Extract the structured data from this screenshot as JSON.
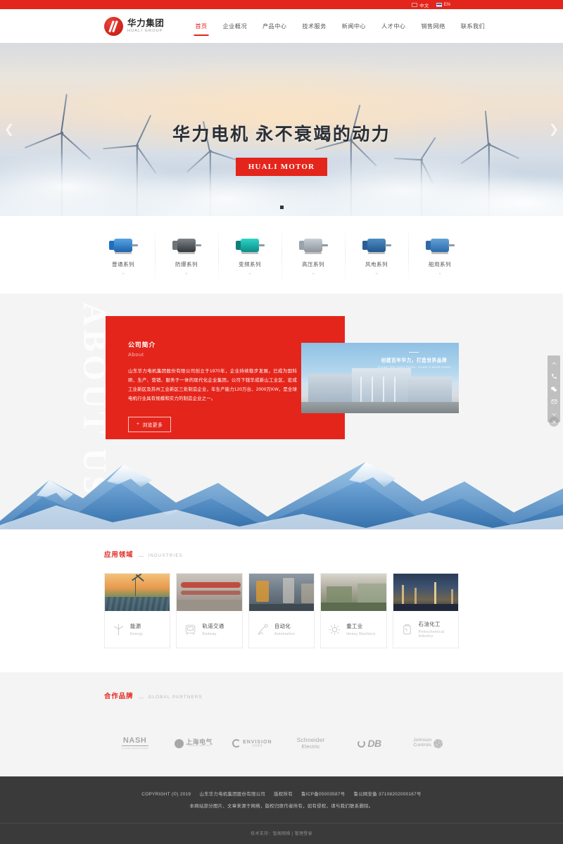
{
  "topbar": {
    "languages": [
      {
        "label": "中文",
        "icon": "cn-flag-icon"
      },
      {
        "label": "EN",
        "icon": "en-flag-icon"
      }
    ]
  },
  "header": {
    "logo_cn": "华力集团",
    "logo_en": "HUALI GROUP",
    "nav": [
      {
        "label": "首页",
        "active": true
      },
      {
        "label": "企业概况",
        "active": false
      },
      {
        "label": "产品中心",
        "active": false
      },
      {
        "label": "技术服务",
        "active": false
      },
      {
        "label": "新闻中心",
        "active": false
      },
      {
        "label": "人才中心",
        "active": false
      },
      {
        "label": "销售网络",
        "active": false
      },
      {
        "label": "联系我们",
        "active": false
      }
    ]
  },
  "hero": {
    "title": "华力电机 永不衰竭的动力",
    "button": "HUALI MOTOR",
    "prev_icon": "chevron-left-icon",
    "next_icon": "chevron-right-icon",
    "slides": 1,
    "active_slide": 1
  },
  "series": {
    "items": [
      {
        "label": "普通系列",
        "color": "#2b7fd0",
        "plus": "+"
      },
      {
        "label": "防爆系列",
        "color": "#4a4a4a",
        "plus": "+"
      },
      {
        "label": "变频系列",
        "color": "#13b3ac",
        "plus": "+"
      },
      {
        "label": "高压系列",
        "color": "#9aa3ab",
        "plus": "+"
      },
      {
        "label": "风电系列",
        "color": "#2f6fa8",
        "plus": "+"
      },
      {
        "label": "船用系列",
        "color": "#3f7fc0",
        "plus": "+"
      }
    ]
  },
  "about": {
    "watermark": "ABOUT US",
    "title": "公司简介",
    "subtitle": "About",
    "paragraph": "山东华力电机集团股份有限公司创立于1970年，企业持续稳步发展，已成为国科研、生产、营销、服务于一体的现代化企业集团。公司下辖华成新山工业区、宏成工业新区及苏州工业新区三处制造企业，年生产能力120万台、2000万KW，是全球电机行业具有规模和实力的制造企业之一。",
    "button": "浏览更多",
    "button_icon": "plus-icon",
    "image_caption_cn": "创建百年华力，打造世界品牌",
    "image_caption_en": "Create 100 years forces, create a world brand"
  },
  "industries": {
    "section_cn": "应用领域",
    "section_en": "INDUSTRIES",
    "cards": [
      {
        "cn": "能源",
        "en": "Energy",
        "icon": "wind-turbine-icon"
      },
      {
        "cn": "轨道交通",
        "en": "Railway",
        "icon": "train-icon"
      },
      {
        "cn": "自动化",
        "en": "Automation",
        "icon": "robot-arm-icon"
      },
      {
        "cn": "重工业",
        "en": "Heavy Machiery",
        "icon": "gear-icon"
      },
      {
        "cn": "石油化工",
        "en": "Petrochemical Industry",
        "icon": "oil-drum-icon"
      }
    ]
  },
  "partners": {
    "section_cn": "合作品牌",
    "section_en": "GLOBAL PARTNERS",
    "logos": [
      {
        "name": "NASH",
        "sub": "A Gardner Denver Product"
      },
      {
        "name": "上海电气",
        "sub": "SHANGHAI ELECTRIC"
      },
      {
        "name": "ENVISION",
        "sub": "远景能源"
      },
      {
        "name": "Schneider",
        "sub": "Electric"
      },
      {
        "name": "DB",
        "sub": ""
      },
      {
        "name": "Johnson",
        "sub": "Controls"
      }
    ]
  },
  "footer": {
    "copyright": "COPYRIGHT (©) 2019",
    "company": "山东华力电机集团股份有限公司",
    "rights": "版权所有",
    "icp": "鲁ICP备05003587号",
    "police": "鲁公网安备 37108202000167号",
    "disclaimer": "本网站部分图片、文章来源于网络，版权归原作者所有，如有侵权，请与我们联系删除。",
    "support_label": "技术支持：",
    "support_value": "智阁网络",
    "separator": "|",
    "admin": "管理登录"
  },
  "floatbar": {
    "items": [
      {
        "icon": "chevron-up-icon",
        "name": "scroll-up"
      },
      {
        "icon": "phone-icon",
        "name": "phone"
      },
      {
        "icon": "wechat-icon",
        "name": "wechat"
      },
      {
        "icon": "mail-icon",
        "name": "mail"
      },
      {
        "icon": "chevron-down-icon",
        "name": "scroll-down"
      }
    ],
    "close_icon": "close-icon"
  },
  "colors": {
    "brand_red": "#e4251b",
    "footer_bg": "#3a3a3a",
    "section_bg": "#f4f4f4"
  }
}
